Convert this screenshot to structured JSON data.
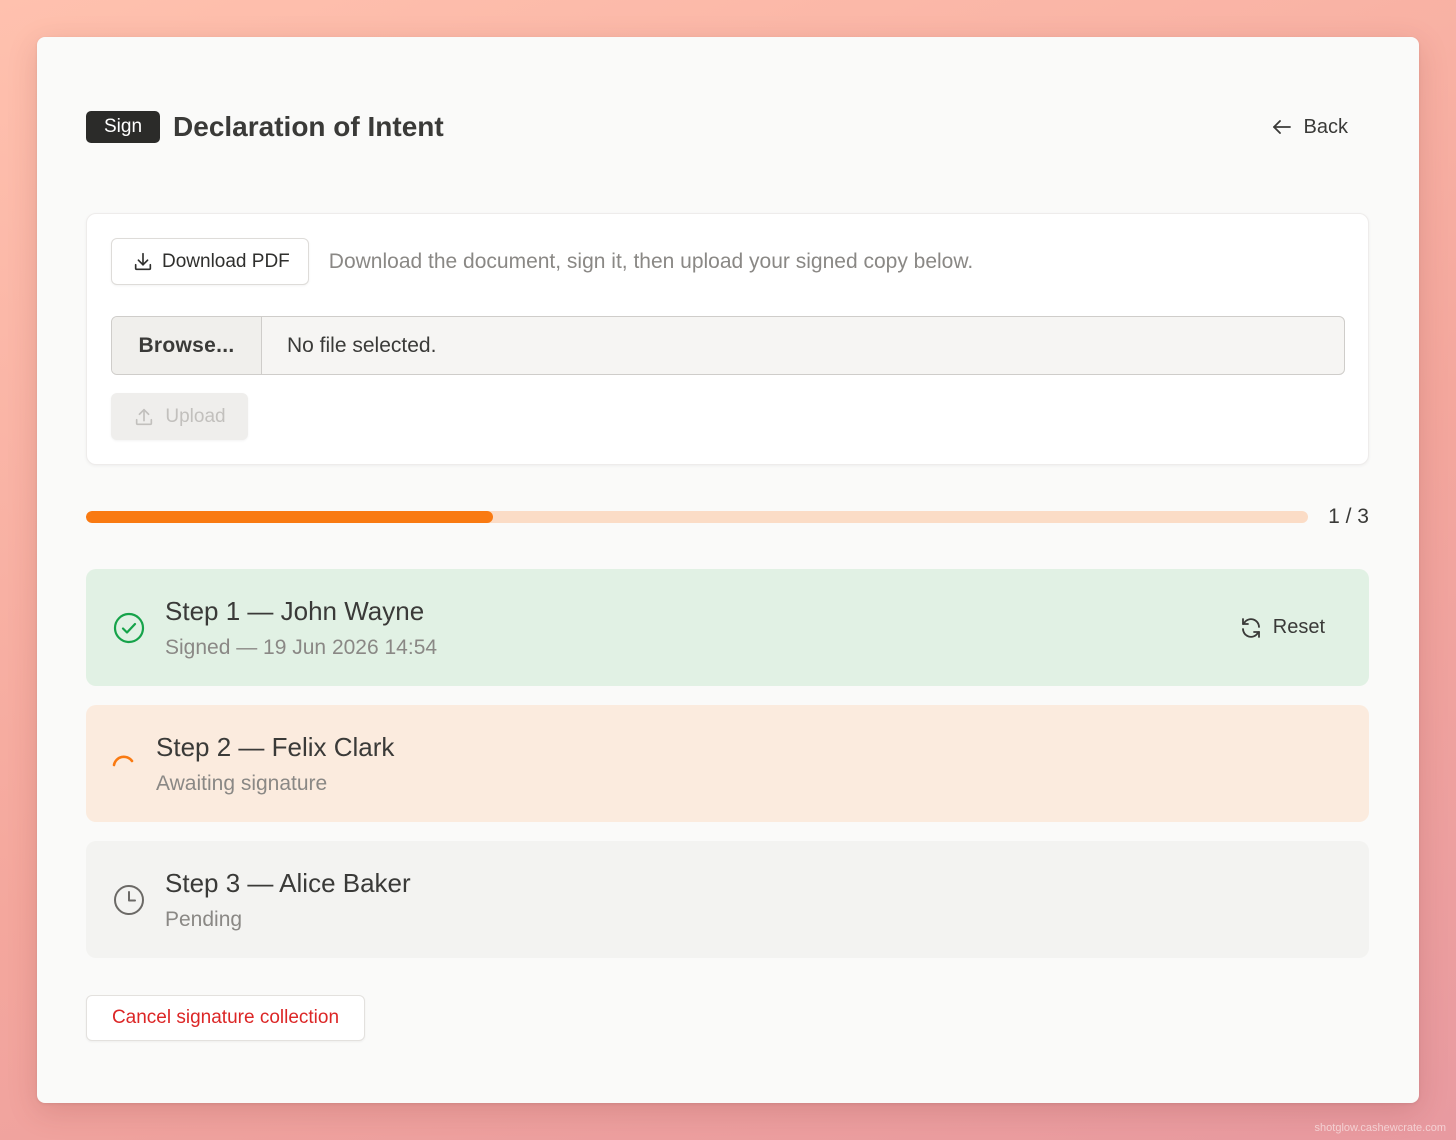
{
  "header": {
    "badge": "Sign",
    "title": "Declaration of Intent",
    "back_label": "Back"
  },
  "upload_card": {
    "download_label": "Download PDF",
    "hint": "Download the document, sign it, then upload your signed copy below.",
    "browse_label": "Browse...",
    "file_status": "No file selected.",
    "upload_label": "Upload"
  },
  "progress": {
    "label": "1 / 3",
    "completed": 1,
    "total": 3
  },
  "steps": [
    {
      "name": "Step 1 — John Wayne",
      "status": "Signed — 19 Jun 2026 14:54",
      "state": "signed",
      "action_label": "Reset"
    },
    {
      "name": "Step 2 — Felix Clark",
      "status": "Awaiting signature",
      "state": "awaiting"
    },
    {
      "name": "Step 3 — Alice Baker",
      "status": "Pending",
      "state": "pending"
    }
  ],
  "cancel_label": "Cancel signature collection",
  "watermark": "shotglow.cashewcrate.com",
  "colors": {
    "accent": "#f97a12",
    "success": "#16a34a",
    "danger": "#dc2626"
  },
  "icons": {
    "back": "arrow-left-icon",
    "download": "download-icon",
    "upload": "upload-icon",
    "signed": "check-circle-icon",
    "awaiting": "spinner-icon",
    "pending": "clock-icon",
    "reset": "refresh-icon"
  }
}
